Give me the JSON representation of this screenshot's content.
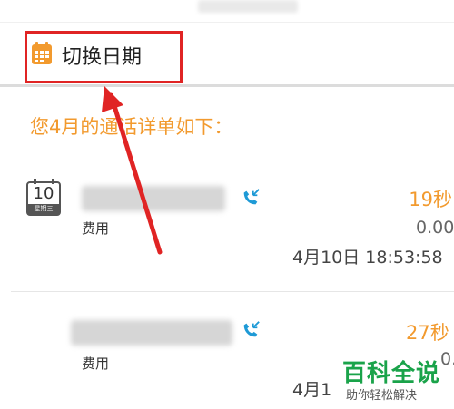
{
  "toolbar": {
    "switch_date_label": "切换日期"
  },
  "summary": {
    "text": "您4月的通话详单如下："
  },
  "records": [
    {
      "day": "10",
      "weekday": "星期三",
      "fee_label": "费用",
      "duration": "19秒",
      "cost": "0.00",
      "timestamp": "4月10日  18:53:58"
    },
    {
      "fee_label": "费用",
      "duration": "27秒",
      "cost": "0.",
      "timestamp": "4月1"
    }
  ],
  "watermark": {
    "title": "百科全说",
    "subtitle": "助你轻松解决"
  },
  "colors": {
    "accent": "#f29a2e",
    "highlight": "#e02424",
    "call_icon": "#1e9ad6",
    "watermark": "#1aa34a"
  },
  "icons": [
    "calendar-icon",
    "date-icon",
    "incoming-call-icon"
  ]
}
